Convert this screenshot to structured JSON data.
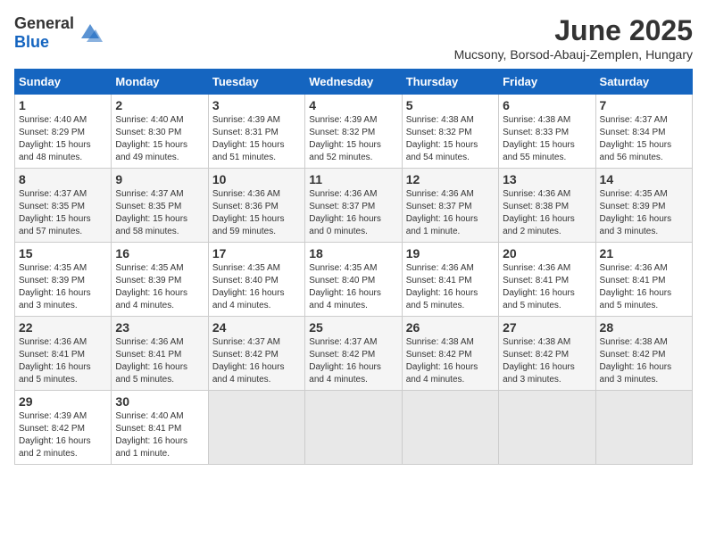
{
  "logo": {
    "general": "General",
    "blue": "Blue"
  },
  "header": {
    "title": "June 2025",
    "subtitle": "Mucsony, Borsod-Abauj-Zemplen, Hungary"
  },
  "weekdays": [
    "Sunday",
    "Monday",
    "Tuesday",
    "Wednesday",
    "Thursday",
    "Friday",
    "Saturday"
  ],
  "weeks": [
    [
      {
        "day": "1",
        "sunrise": "4:40 AM",
        "sunset": "8:29 PM",
        "daylight": "15 hours and 48 minutes."
      },
      {
        "day": "2",
        "sunrise": "4:40 AM",
        "sunset": "8:30 PM",
        "daylight": "15 hours and 49 minutes."
      },
      {
        "day": "3",
        "sunrise": "4:39 AM",
        "sunset": "8:31 PM",
        "daylight": "15 hours and 51 minutes."
      },
      {
        "day": "4",
        "sunrise": "4:39 AM",
        "sunset": "8:32 PM",
        "daylight": "15 hours and 52 minutes."
      },
      {
        "day": "5",
        "sunrise": "4:38 AM",
        "sunset": "8:32 PM",
        "daylight": "15 hours and 54 minutes."
      },
      {
        "day": "6",
        "sunrise": "4:38 AM",
        "sunset": "8:33 PM",
        "daylight": "15 hours and 55 minutes."
      },
      {
        "day": "7",
        "sunrise": "4:37 AM",
        "sunset": "8:34 PM",
        "daylight": "15 hours and 56 minutes."
      }
    ],
    [
      {
        "day": "8",
        "sunrise": "4:37 AM",
        "sunset": "8:35 PM",
        "daylight": "15 hours and 57 minutes."
      },
      {
        "day": "9",
        "sunrise": "4:37 AM",
        "sunset": "8:35 PM",
        "daylight": "15 hours and 58 minutes."
      },
      {
        "day": "10",
        "sunrise": "4:36 AM",
        "sunset": "8:36 PM",
        "daylight": "15 hours and 59 minutes."
      },
      {
        "day": "11",
        "sunrise": "4:36 AM",
        "sunset": "8:37 PM",
        "daylight": "16 hours and 0 minutes."
      },
      {
        "day": "12",
        "sunrise": "4:36 AM",
        "sunset": "8:37 PM",
        "daylight": "16 hours and 1 minute."
      },
      {
        "day": "13",
        "sunrise": "4:36 AM",
        "sunset": "8:38 PM",
        "daylight": "16 hours and 2 minutes."
      },
      {
        "day": "14",
        "sunrise": "4:35 AM",
        "sunset": "8:39 PM",
        "daylight": "16 hours and 3 minutes."
      }
    ],
    [
      {
        "day": "15",
        "sunrise": "4:35 AM",
        "sunset": "8:39 PM",
        "daylight": "16 hours and 3 minutes."
      },
      {
        "day": "16",
        "sunrise": "4:35 AM",
        "sunset": "8:39 PM",
        "daylight": "16 hours and 4 minutes."
      },
      {
        "day": "17",
        "sunrise": "4:35 AM",
        "sunset": "8:40 PM",
        "daylight": "16 hours and 4 minutes."
      },
      {
        "day": "18",
        "sunrise": "4:35 AM",
        "sunset": "8:40 PM",
        "daylight": "16 hours and 4 minutes."
      },
      {
        "day": "19",
        "sunrise": "4:36 AM",
        "sunset": "8:41 PM",
        "daylight": "16 hours and 5 minutes."
      },
      {
        "day": "20",
        "sunrise": "4:36 AM",
        "sunset": "8:41 PM",
        "daylight": "16 hours and 5 minutes."
      },
      {
        "day": "21",
        "sunrise": "4:36 AM",
        "sunset": "8:41 PM",
        "daylight": "16 hours and 5 minutes."
      }
    ],
    [
      {
        "day": "22",
        "sunrise": "4:36 AM",
        "sunset": "8:41 PM",
        "daylight": "16 hours and 5 minutes."
      },
      {
        "day": "23",
        "sunrise": "4:36 AM",
        "sunset": "8:41 PM",
        "daylight": "16 hours and 5 minutes."
      },
      {
        "day": "24",
        "sunrise": "4:37 AM",
        "sunset": "8:42 PM",
        "daylight": "16 hours and 4 minutes."
      },
      {
        "day": "25",
        "sunrise": "4:37 AM",
        "sunset": "8:42 PM",
        "daylight": "16 hours and 4 minutes."
      },
      {
        "day": "26",
        "sunrise": "4:38 AM",
        "sunset": "8:42 PM",
        "daylight": "16 hours and 4 minutes."
      },
      {
        "day": "27",
        "sunrise": "4:38 AM",
        "sunset": "8:42 PM",
        "daylight": "16 hours and 3 minutes."
      },
      {
        "day": "28",
        "sunrise": "4:38 AM",
        "sunset": "8:42 PM",
        "daylight": "16 hours and 3 minutes."
      }
    ],
    [
      {
        "day": "29",
        "sunrise": "4:39 AM",
        "sunset": "8:42 PM",
        "daylight": "16 hours and 2 minutes."
      },
      {
        "day": "30",
        "sunrise": "4:40 AM",
        "sunset": "8:41 PM",
        "daylight": "16 hours and 1 minute."
      },
      null,
      null,
      null,
      null,
      null
    ]
  ]
}
